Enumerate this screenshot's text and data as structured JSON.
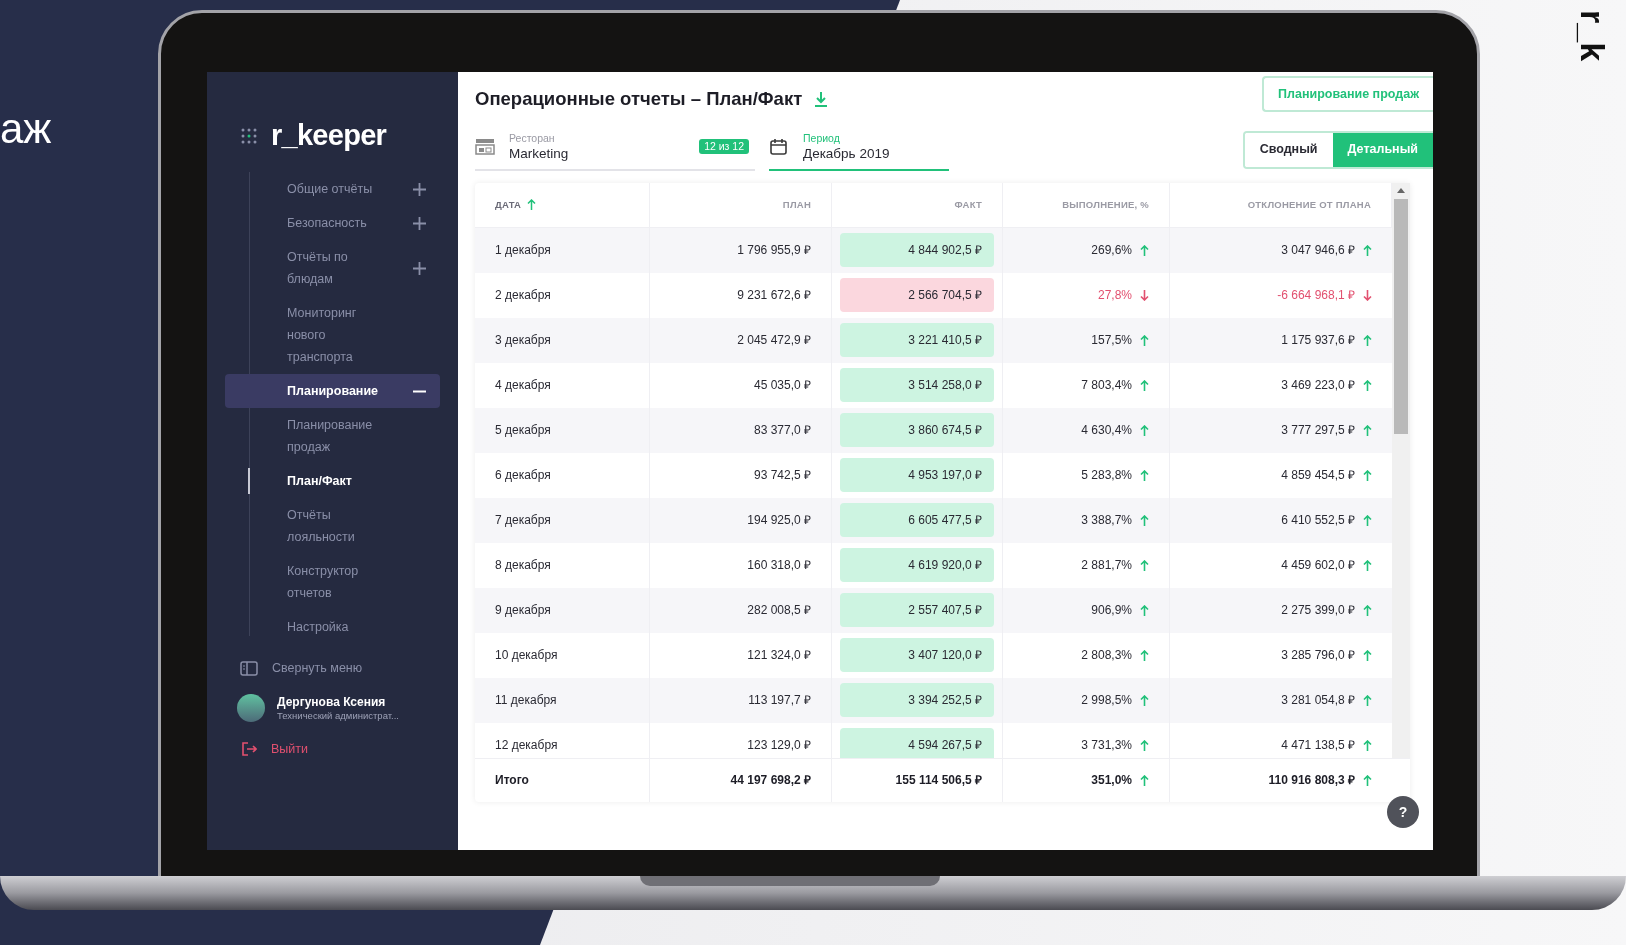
{
  "backdrop": {
    "heading_fragment": "аж",
    "corner_logo": "r_k"
  },
  "sidebar": {
    "logo": "r_keeper",
    "items": [
      {
        "label": "Общие отчёты",
        "kind": "group",
        "expanded": false,
        "selected": false
      },
      {
        "label": "Безопасность",
        "kind": "group",
        "expanded": false,
        "selected": false
      },
      {
        "label": "Отчёты по блюдам",
        "kind": "group",
        "expanded": false,
        "selected": false
      },
      {
        "label": "Мониторинг нового транспорта",
        "kind": "link",
        "selected": false
      },
      {
        "label": "Планирование",
        "kind": "group",
        "expanded": true,
        "selected": true,
        "children": [
          {
            "label": "Планирование продаж",
            "kind": "link",
            "selected": false
          },
          {
            "label": "План/Факт",
            "kind": "link",
            "selected": true
          }
        ]
      },
      {
        "label": "Отчёты лояльности",
        "kind": "link",
        "selected": false
      },
      {
        "label": "Конструктор отчетов",
        "kind": "link",
        "selected": false
      },
      {
        "label": "Настройка",
        "kind": "link",
        "selected": false
      }
    ],
    "collapse": "Свернуть меню",
    "user": {
      "name": "Дергунова Ксения",
      "role": "Технический администрат..."
    },
    "logout": "Выйти"
  },
  "main": {
    "title": "Операционные отчеты – План/Факт",
    "action_button": "Планирование продаж",
    "filters": [
      {
        "label": "Ресторан",
        "value": "Marketing",
        "badge": "12 из 12",
        "active": false,
        "kind": "restaurant"
      },
      {
        "label": "Период",
        "value": "Декабрь 2019",
        "active": true,
        "kind": "calendar"
      }
    ],
    "view_toggle": [
      {
        "label": "Сводный",
        "selected": false
      },
      {
        "label": "Детальный",
        "selected": true
      }
    ],
    "table": {
      "columns": [
        {
          "label": "ДАТА",
          "sorted": true
        },
        {
          "label": "ПЛАН",
          "sorted": false
        },
        {
          "label": "ФАКТ",
          "sorted": false
        },
        {
          "label": "ВЫПОЛНЕНИЕ, %",
          "sorted": false
        },
        {
          "label": "ОТКЛОНЕНИЕ ОТ ПЛАНА",
          "sorted": false
        }
      ],
      "rows": [
        {
          "date": "1 декабря",
          "plan": "1 796 955,9 ₽",
          "fact": "4 844 902,5 ₽",
          "completion": "269,6%",
          "deviation": "3 047 946,6 ₽",
          "rising": true
        },
        {
          "date": "2 декабря",
          "plan": "9 231 672,6 ₽",
          "fact": "2 566 704,5 ₽",
          "completion": "27,8%",
          "deviation": "-6 664 968,1 ₽",
          "rising": false
        },
        {
          "date": "3 декабря",
          "plan": "2 045 472,9 ₽",
          "fact": "3 221 410,5 ₽",
          "completion": "157,5%",
          "deviation": "1 175 937,6 ₽",
          "rising": true
        },
        {
          "date": "4 декабря",
          "plan": "45 035,0 ₽",
          "fact": "3 514 258,0 ₽",
          "completion": "7 803,4%",
          "deviation": "3 469 223,0 ₽",
          "rising": true
        },
        {
          "date": "5 декабря",
          "plan": "83 377,0 ₽",
          "fact": "3 860 674,5 ₽",
          "completion": "4 630,4%",
          "deviation": "3 777 297,5 ₽",
          "rising": true
        },
        {
          "date": "6 декабря",
          "plan": "93 742,5 ₽",
          "fact": "4 953 197,0 ₽",
          "completion": "5 283,8%",
          "deviation": "4 859 454,5 ₽",
          "rising": true
        },
        {
          "date": "7 декабря",
          "plan": "194 925,0 ₽",
          "fact": "6 605 477,5 ₽",
          "completion": "3 388,7%",
          "deviation": "6 410 552,5 ₽",
          "rising": true
        },
        {
          "date": "8 декабря",
          "plan": "160 318,0 ₽",
          "fact": "4 619 920,0 ₽",
          "completion": "2 881,7%",
          "deviation": "4 459 602,0 ₽",
          "rising": true
        },
        {
          "date": "9 декабря",
          "plan": "282 008,5 ₽",
          "fact": "2 557 407,5 ₽",
          "completion": "906,9%",
          "deviation": "2 275 399,0 ₽",
          "rising": true
        },
        {
          "date": "10 декабря",
          "plan": "121 324,0 ₽",
          "fact": "3 407 120,0 ₽",
          "completion": "2 808,3%",
          "deviation": "3 285 796,0 ₽",
          "rising": true
        },
        {
          "date": "11 декабря",
          "plan": "113 197,7 ₽",
          "fact": "3 394 252,5 ₽",
          "completion": "2 998,5%",
          "deviation": "3 281 054,8 ₽",
          "rising": true
        },
        {
          "date": "12 декабря",
          "plan": "123 129,0 ₽",
          "fact": "4 594 267,5 ₽",
          "completion": "3 731,3%",
          "deviation": "4 471 138,5 ₽",
          "rising": true
        }
      ],
      "total": {
        "date": "Итого",
        "plan": "44 197 698,2 ₽",
        "fact": "155 114 506,5 ₽",
        "completion": "351,0%",
        "deviation": "110 916 808,3 ₽",
        "rising": true
      }
    },
    "help_button": "?"
  }
}
